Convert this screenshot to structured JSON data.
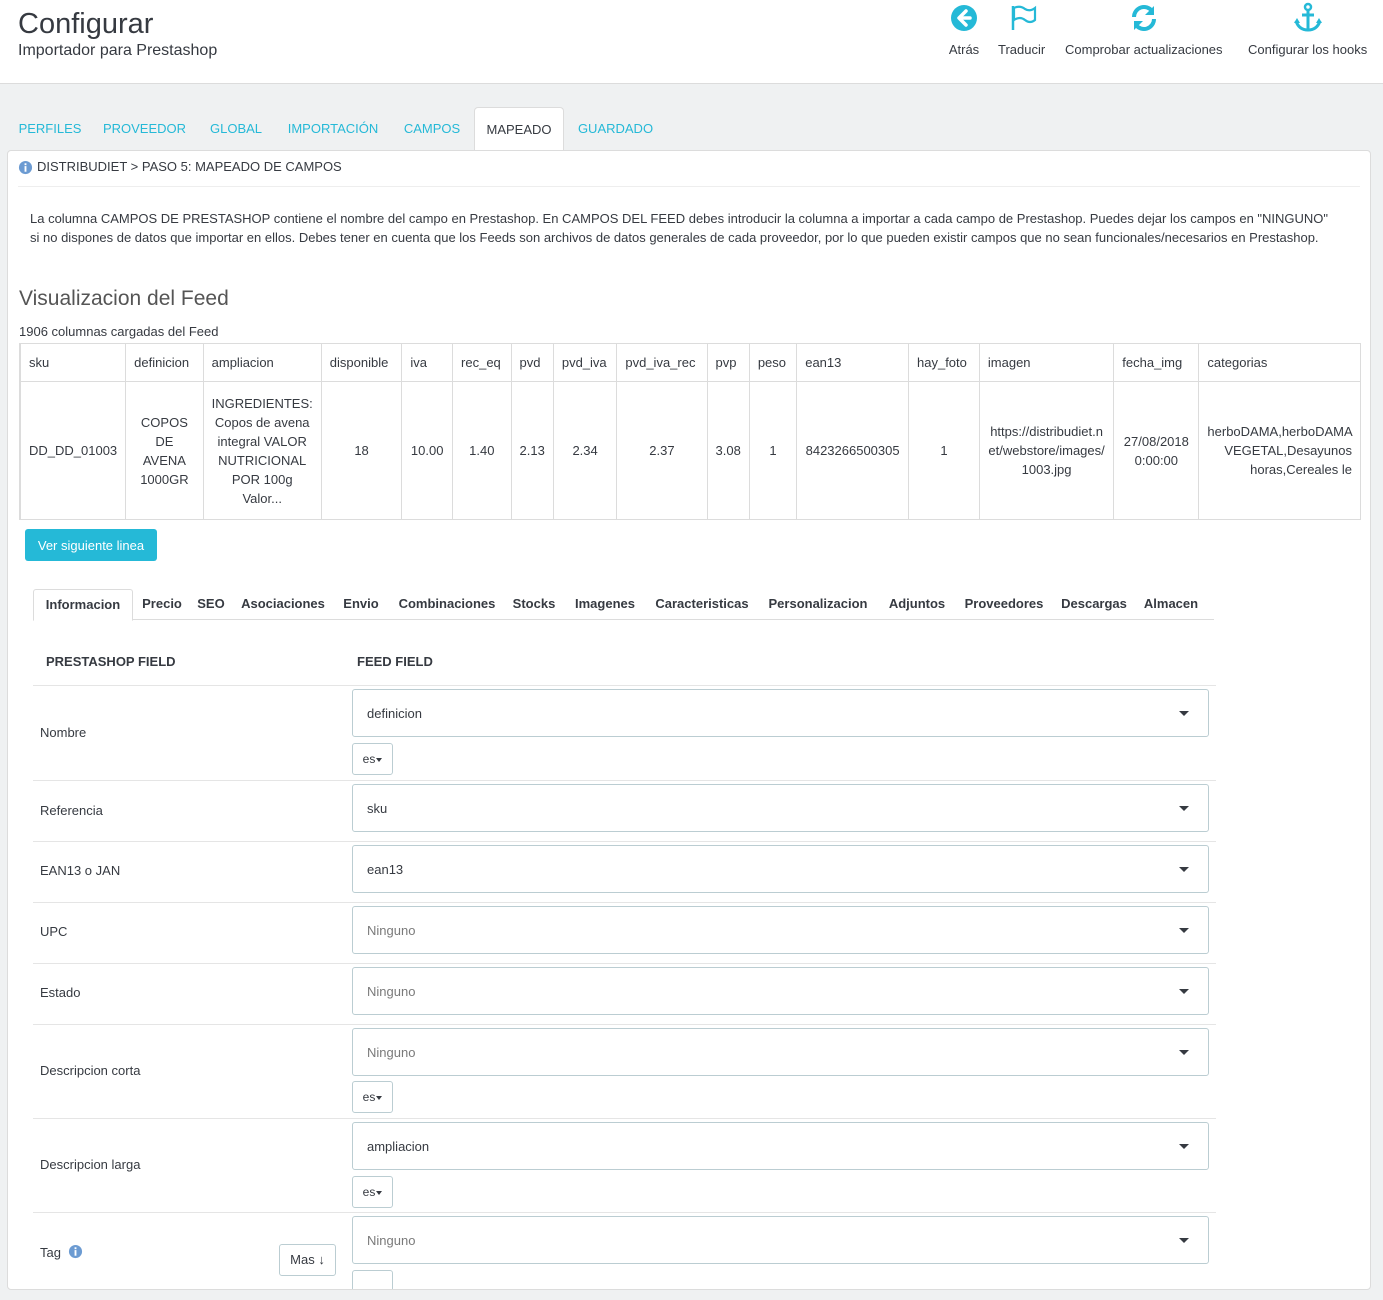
{
  "header": {
    "title": "Configurar",
    "subtitle": "Importador para Prestashop",
    "toolbar": [
      {
        "label": "Atrás",
        "icon": "arrow-circle-left-icon"
      },
      {
        "label": "Traducir",
        "icon": "flag-icon"
      },
      {
        "label": "Comprobar actualizaciones",
        "icon": "refresh-icon"
      },
      {
        "label": "Configurar los hooks",
        "icon": "anchor-icon"
      }
    ]
  },
  "tabs": [
    "PERFILES",
    "PROVEEDOR",
    "GLOBAL",
    "IMPORTACIÓN",
    "CAMPOS",
    "MAPEADO",
    "GUARDADO"
  ],
  "active_tab": "MAPEADO",
  "panel": {
    "heading": "DISTRIBUDIET > PASO 5: MAPEADO DE CAMPOS",
    "description": "La columna CAMPOS DE PRESTASHOP contiene el nombre del campo en Prestashop. En CAMPOS DEL FEED debes introducir la columna a importar a cada campo de Prestashop. Puedes dejar los campos en \"NINGUNO\" si no dispones de datos que importar en ellos. Debes tener en cuenta que los Feeds son archivos de datos generales de cada proveedor, por lo que pueden existir campos que no sean funcionales/necesarios en Prestashop.",
    "feed_title": "Visualizacion del Feed",
    "columns_loaded": "1906 columnas cargadas del Feed"
  },
  "feed_table": {
    "headers": [
      "sku",
      "definicion",
      "ampliacion",
      "disponible",
      "iva",
      "rec_eq",
      "pvd",
      "pvd_iva",
      "pvd_iva_rec",
      "pvp",
      "peso",
      "ean13",
      "hay_foto",
      "imagen",
      "fecha_img",
      "categorias"
    ],
    "row": [
      "DD_DD_01003",
      "COPOS DE AVENA 1000GR",
      "INGREDIENTES: Copos de avena integral VALOR NUTRICIONAL POR 100g Valor...",
      "18",
      "10.00",
      "1.40",
      "2.13",
      "2.34",
      "2.37",
      "3.08",
      "1",
      "8423266500305",
      "1",
      "https://distribudiet.net/webstore/images/1003.jpg",
      "27/08/2018 0:00:00",
      "herboDAMA,herboDAMA VEGETAL,Desayunos horas,Cereales le"
    ]
  },
  "next_line_button": "Ver siguiente linea",
  "subtabs": [
    "Informacion",
    "Precio",
    "SEO",
    "Asociaciones",
    "Envio",
    "Combinaciones",
    "Stocks",
    "Imagenes",
    "Caracteristicas",
    "Personalizacion",
    "Adjuntos",
    "Proveedores",
    "Descargas",
    "Almacen"
  ],
  "active_subtab": "Informacion",
  "mapping": {
    "col_prestashop": "PRESTASHOP FIELD",
    "col_feed": "FEED FIELD",
    "lang_label": "es",
    "more_button": "Mas ↓",
    "rows": [
      {
        "label": "Nombre",
        "value": "definicion",
        "placeholder": false
      },
      {
        "label": "Referencia",
        "value": "sku",
        "placeholder": false
      },
      {
        "label": "EAN13 o JAN",
        "value": "ean13",
        "placeholder": false
      },
      {
        "label": "UPC",
        "value": "Ninguno",
        "placeholder": true
      },
      {
        "label": "Estado",
        "value": "Ninguno",
        "placeholder": true
      },
      {
        "label": "Descripcion corta",
        "value": "Ninguno",
        "placeholder": true
      },
      {
        "label": "Descripcion larga",
        "value": "ampliacion",
        "placeholder": false
      },
      {
        "label": "Tag",
        "value": "Ninguno",
        "placeholder": true
      }
    ]
  },
  "colors": {
    "accent": "#25b9d7",
    "text": "#363a41",
    "border": "#bbcdd2"
  }
}
